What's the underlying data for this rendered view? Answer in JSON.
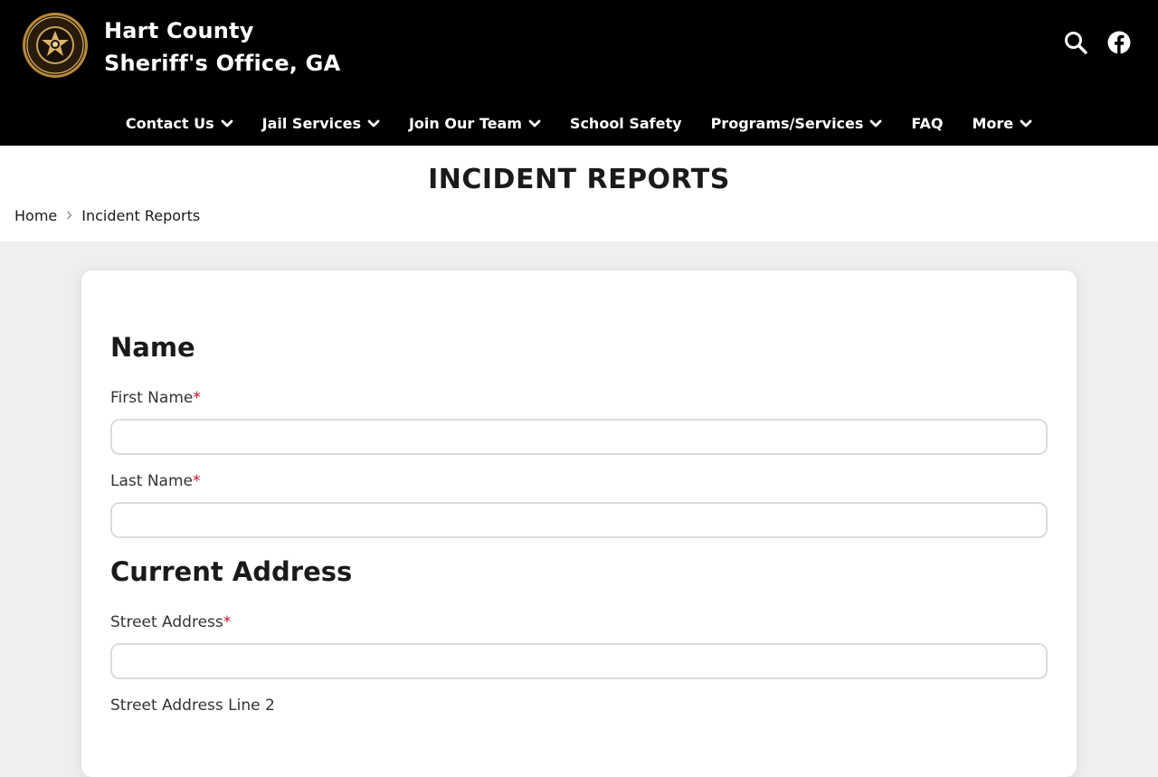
{
  "header": {
    "site_title_line1": "Hart County",
    "site_title_line2": "Sheriff's Office, GA",
    "logo_icon": "sheriff-seal-icon",
    "search_icon": "search-icon",
    "social_icon": "facebook-icon"
  },
  "nav": {
    "items": [
      {
        "label": "Contact Us",
        "has_dropdown": true
      },
      {
        "label": "Jail Services",
        "has_dropdown": true
      },
      {
        "label": "Join Our Team",
        "has_dropdown": true
      },
      {
        "label": "School Safety",
        "has_dropdown": false
      },
      {
        "label": "Programs/Services",
        "has_dropdown": true
      },
      {
        "label": "FAQ",
        "has_dropdown": false
      },
      {
        "label": "More",
        "has_dropdown": true
      }
    ]
  },
  "page": {
    "title": "INCIDENT REPORTS",
    "breadcrumb": [
      "Home",
      "Incident Reports"
    ]
  },
  "form": {
    "sections": [
      {
        "heading": "Name"
      },
      {
        "heading": "Current Address"
      }
    ],
    "fields": [
      {
        "label": "First Name",
        "required": true,
        "value": ""
      },
      {
        "label": "Last Name",
        "required": true,
        "value": ""
      },
      {
        "label": "Street Address",
        "required": true,
        "value": ""
      },
      {
        "label": "Street Address Line 2",
        "required": false,
        "value": ""
      }
    ],
    "required_marker": "*"
  },
  "colors": {
    "header_bg": "#000000",
    "required": "#c8102e",
    "page_bg": "#efefef"
  }
}
